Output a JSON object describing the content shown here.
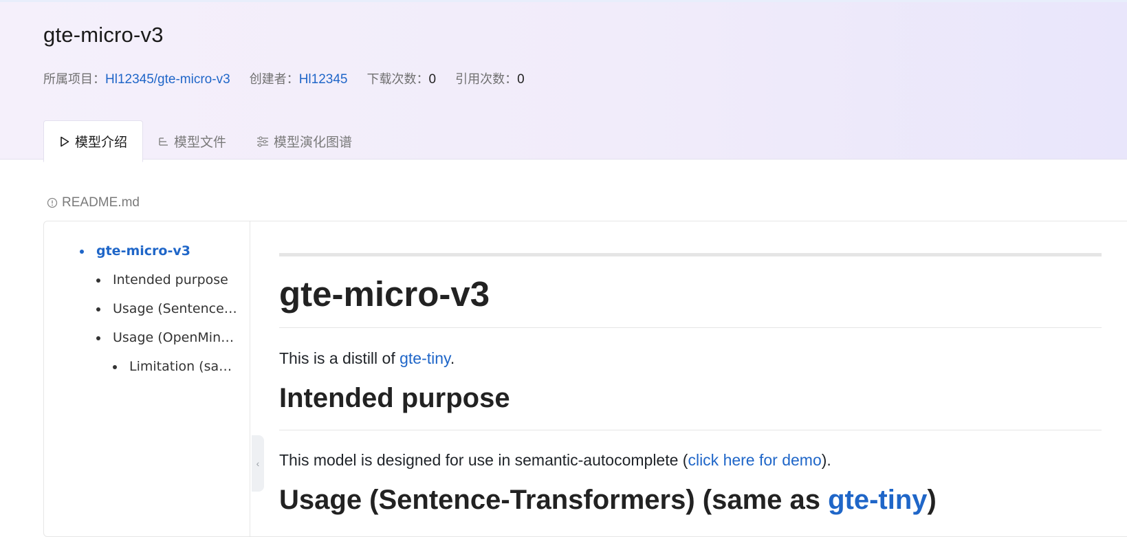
{
  "header": {
    "title": "gte-micro-v3",
    "meta": {
      "project_label": "所属项目：",
      "project_value": "Hl12345/gte-micro-v3",
      "creator_label": "创建者：",
      "creator_value": "Hl12345",
      "downloads_label": "下载次数：",
      "downloads_value": "0",
      "citations_label": "引用次数：",
      "citations_value": "0"
    },
    "tabs": [
      {
        "label": "模型介绍",
        "icon": "play-outline-icon",
        "active": true
      },
      {
        "label": "模型文件",
        "icon": "file-lines-icon",
        "active": false
      },
      {
        "label": "模型演化图谱",
        "icon": "sliders-icon",
        "active": false
      }
    ]
  },
  "readme": {
    "label": "README.md",
    "icon": "info-circle-icon"
  },
  "toc": {
    "items": [
      {
        "label": "gte-micro-v3",
        "level": 0,
        "active": true
      },
      {
        "label": "Intended purpose",
        "level": 1
      },
      {
        "label": "Usage (Sentence…",
        "level": 1
      },
      {
        "label": "Usage (OpenMin…",
        "level": 1
      },
      {
        "label": "Limitation (sa…",
        "level": 2
      }
    ],
    "collapse_icon": "chevron-left-icon"
  },
  "markdown": {
    "h1": "gte-micro-v3",
    "p1_before": "This is a distill of ",
    "p1_link": "gte-tiny",
    "p1_after": ".",
    "h2_intended": "Intended purpose",
    "p2_before": "This model is designed for use in semantic-autocomplete (",
    "p2_link": "click here for demo",
    "p2_after": ").",
    "h2_usage_before": "Usage (Sentence-Transformers) (same as ",
    "h2_usage_link": "gte-tiny",
    "h2_usage_after": ")"
  },
  "colors": {
    "link": "#1f66c8",
    "header_bg_start": "#f5f0fb",
    "header_bg_end": "#e9e6fb"
  }
}
